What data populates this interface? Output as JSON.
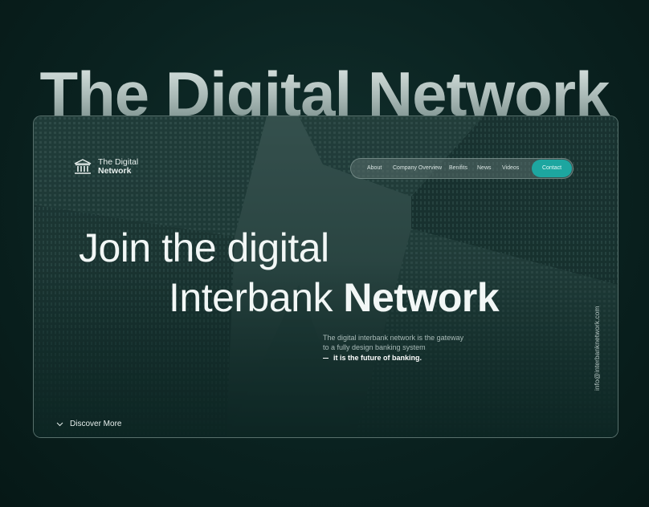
{
  "hero_banner": {
    "big_title": "The Digital Network"
  },
  "brand": {
    "name_line1": "The Digital",
    "name_line2": "Network",
    "logo_icon": "bank-building-icon"
  },
  "nav": {
    "items": [
      {
        "label": "About"
      },
      {
        "label": "Company Overview"
      },
      {
        "label": "Benifits"
      },
      {
        "label": "News"
      },
      {
        "label": "Videos"
      }
    ],
    "contact_label": "Contact"
  },
  "hero": {
    "line1": "Join the digital",
    "line2_regular": "Interbank",
    "line2_bold": "Network"
  },
  "description": {
    "line1": "The digital interbank network is the gateway",
    "line2": "to a fully design banking system",
    "line3": "it is the future of banking."
  },
  "discover": {
    "label": "Discover More",
    "icon": "chevron-down-icon"
  },
  "contact_email": "info@interbanknetwork.com",
  "colors": {
    "background": "#08201e",
    "accent": "#1da6a0",
    "text": "#f2f7f6"
  }
}
